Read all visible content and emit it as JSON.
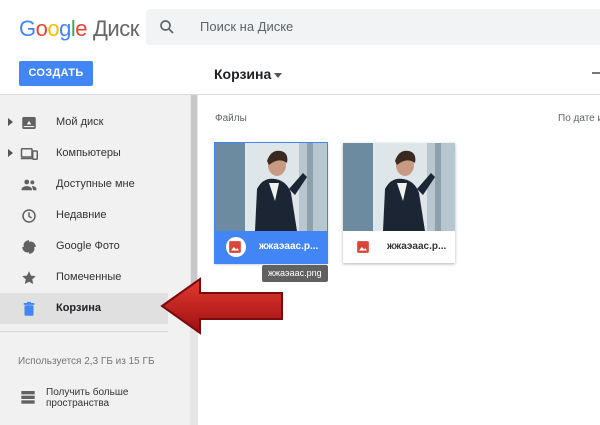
{
  "header": {
    "logo_text": "Google",
    "product_name": "Диск",
    "search_placeholder": "Поиск на Диске"
  },
  "toolbar": {
    "create_label": "СОЗДАТЬ",
    "location_label": "Корзина"
  },
  "sidebar": {
    "items": [
      {
        "label": "Мой диск",
        "icon": "drive-icon",
        "expandable": true
      },
      {
        "label": "Компьютеры",
        "icon": "computers-icon",
        "expandable": true
      },
      {
        "label": "Доступные мне",
        "icon": "shared-icon",
        "expandable": false
      },
      {
        "label": "Недавние",
        "icon": "clock-icon",
        "expandable": false
      },
      {
        "label": "Google Фото",
        "icon": "photos-icon",
        "expandable": false
      },
      {
        "label": "Помеченные",
        "icon": "star-icon",
        "expandable": false
      },
      {
        "label": "Корзина",
        "icon": "trash-icon",
        "expandable": false,
        "active": true
      }
    ],
    "storage_text": "Используется 2,3 ГБ из 15 ГБ",
    "get_more_line1": "Получить больше",
    "get_more_line2": "пространства"
  },
  "main": {
    "section_title": "Файлы",
    "sort_label": "По дате и",
    "files": [
      {
        "name": "жжаэаас.р...",
        "selected": true
      },
      {
        "name": "жжаэаас.р...",
        "selected": false
      }
    ],
    "tooltip": "жжаэаас.png"
  },
  "colors": {
    "accent": "#4285f4",
    "annotation_arrow": "#c4141a",
    "image_icon": "#db4437"
  }
}
